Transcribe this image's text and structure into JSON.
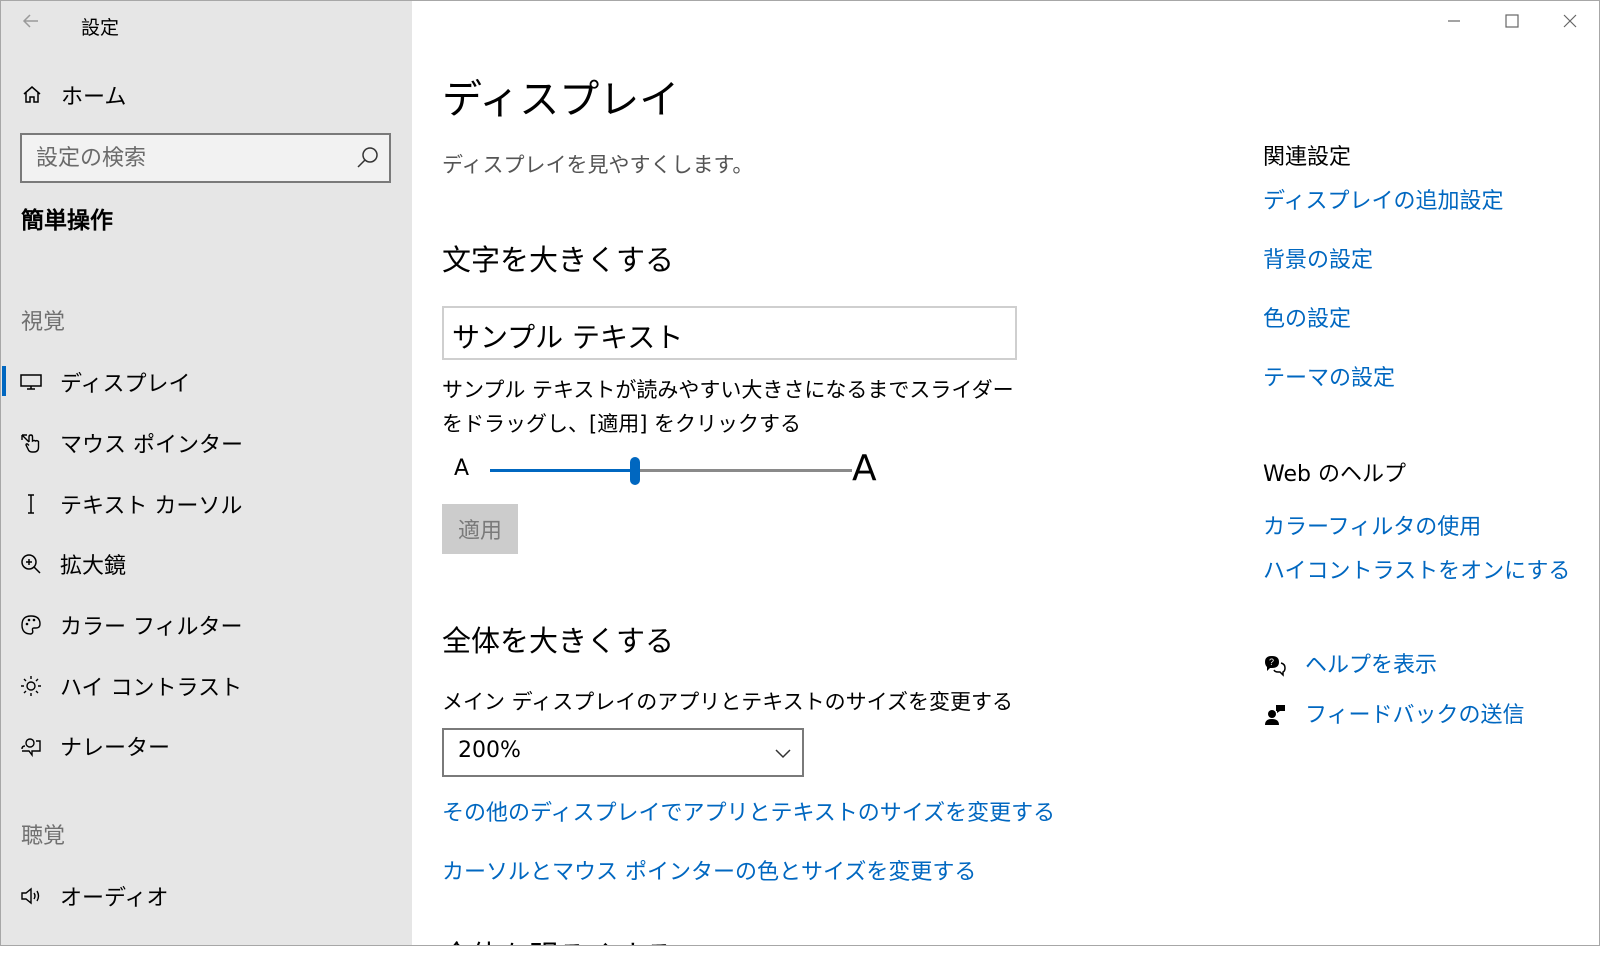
{
  "window": {
    "title": "設定",
    "controls": {
      "minimize": "—",
      "maximize": "☐",
      "close": "✕"
    }
  },
  "sidebar": {
    "home_label": "ホーム",
    "search_placeholder": "設定の検索",
    "category": "簡単操作",
    "sections": [
      {
        "label": "視覚",
        "items": [
          {
            "label": "ディスプレイ",
            "icon": "monitor-icon",
            "selected": true
          },
          {
            "label": "マウス ポインター",
            "icon": "mouse-pointer-icon"
          },
          {
            "label": "テキスト カーソル",
            "icon": "text-cursor-icon"
          },
          {
            "label": "拡大鏡",
            "icon": "magnifier-icon"
          },
          {
            "label": "カラー フィルター",
            "icon": "color-palette-icon"
          },
          {
            "label": "ハイ コントラスト",
            "icon": "brightness-icon"
          },
          {
            "label": "ナレーター",
            "icon": "narrator-icon"
          }
        ]
      },
      {
        "label": "聴覚",
        "items": [
          {
            "label": "オーディオ",
            "icon": "speaker-icon"
          }
        ]
      }
    ]
  },
  "main": {
    "title": "ディスプレイ",
    "subtitle": "ディスプレイを見やすくします。",
    "text_section": {
      "heading": "文字を大きくする",
      "sample_text": "サンプル テキスト",
      "description": "サンプル テキストが読みやすい大きさになるまでスライダーをドラッグし、[適用] をクリックする",
      "slider_small_label": "A",
      "slider_large_label": "A",
      "slider_value_fraction": 0.4,
      "apply_label": "適用"
    },
    "scale_section": {
      "heading": "全体を大きくする",
      "field_label": "メイン ディスプレイのアプリとテキストのサイズを変更する",
      "scale_value": "200%",
      "link_other_displays": "その他のディスプレイでアプリとテキストのサイズを変更する",
      "link_cursor_pointer": "カーソルとマウス ポインターの色とサイズを変更する"
    },
    "next_heading_partial": "全体を明るくする"
  },
  "related": {
    "title": "関連設定",
    "links": [
      "ディスプレイの追加設定",
      "背景の設定",
      "色の設定",
      "テーマの設定"
    ],
    "web_help_title": "Web のヘルプ",
    "web_help_links": [
      "カラーフィルタの使用",
      "ハイコントラストをオンにする"
    ],
    "show_help": "ヘルプを表示",
    "send_feedback": "フィードバックの送信"
  },
  "colors": {
    "accent": "#0067c0",
    "sidebar_bg": "#e6e6e6",
    "disabled_button_bg": "#cccccc"
  }
}
